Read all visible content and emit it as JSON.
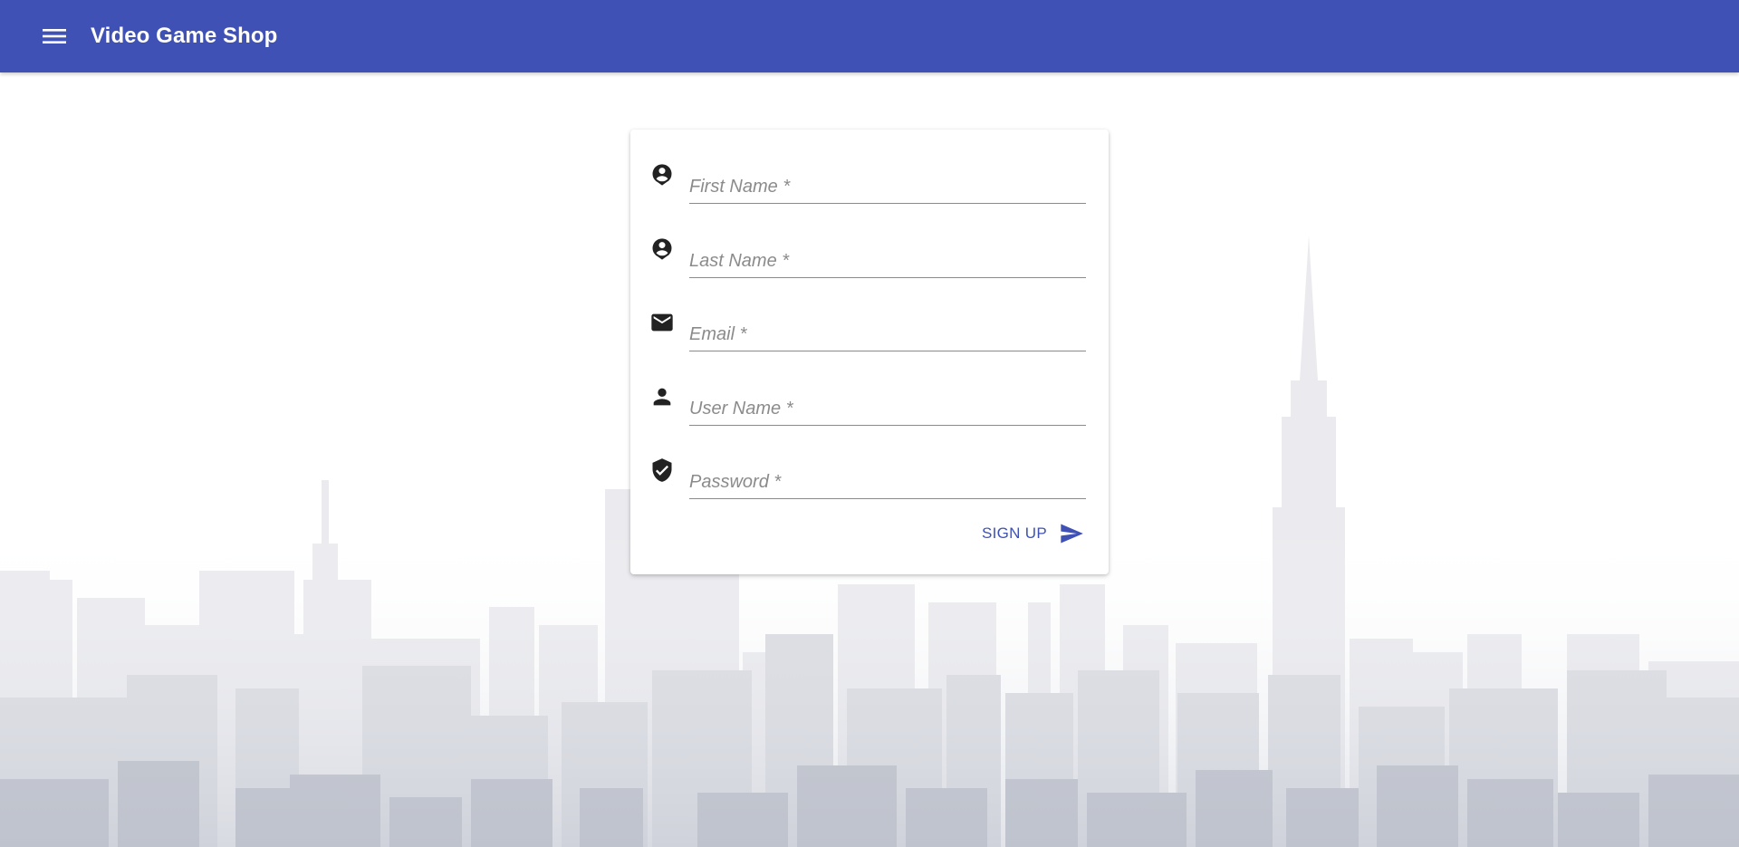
{
  "colors": {
    "primary": "#3f51b5",
    "icon": "#222222",
    "skyline_light": "#e8e8ec",
    "skyline_dark": "#a4a9b6"
  },
  "app": {
    "title": "Video Game Shop",
    "menu_icon": "hamburger-menu-icon"
  },
  "form": {
    "fields": [
      {
        "id": "first-name",
        "icon": "account-circle-icon",
        "placeholder": "First Name *",
        "value": ""
      },
      {
        "id": "last-name",
        "icon": "account-circle-icon",
        "placeholder": "Last Name *",
        "value": ""
      },
      {
        "id": "email",
        "icon": "email-icon",
        "placeholder": "Email *",
        "value": ""
      },
      {
        "id": "user-name",
        "icon": "person-icon",
        "placeholder": "User Name *",
        "value": ""
      },
      {
        "id": "password",
        "icon": "verified-shield-icon",
        "placeholder": "Password *",
        "value": ""
      }
    ],
    "submit_label": "SIGN UP",
    "submit_icon": "send-icon"
  }
}
